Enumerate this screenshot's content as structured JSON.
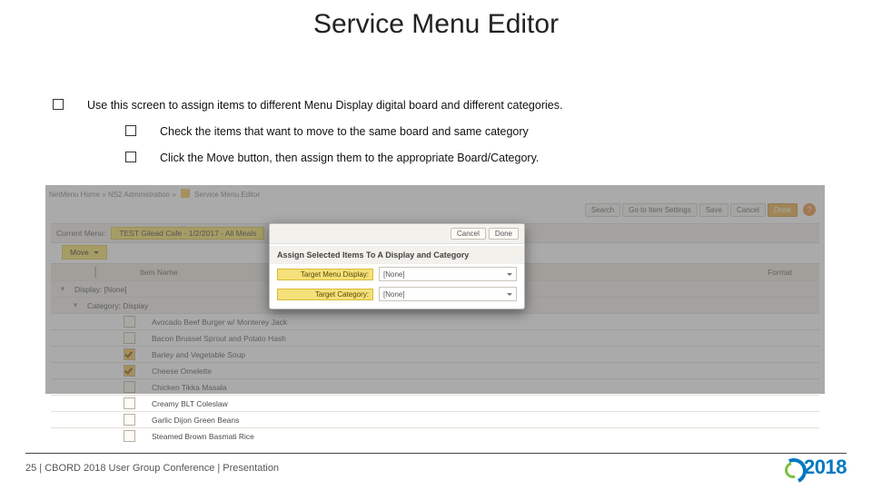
{
  "title": "Service Menu Editor",
  "bullets": {
    "main": "Use this screen to assign items to different Menu Display digital board and different categories.",
    "sub1": "Check the items that want to move to the same board and same category",
    "sub2": "Click the Move button, then assign them to the appropriate Board/Category."
  },
  "screenshot": {
    "breadcrumb": {
      "a": "NetMenu Home",
      "b": "NS2 Administration",
      "c": "Service Menu Editor"
    },
    "toolbar": {
      "search": "Search",
      "goto": "Go to Item Settings",
      "save": "Save",
      "cancel": "Cancel",
      "done": "Done"
    },
    "current_menu": {
      "label": "Current Menu:",
      "value": "TEST Gilead Cafe - 1/2/2017 - All Meals",
      "all": "All"
    },
    "move_btn": "Move",
    "table": {
      "col_item": "Item Name",
      "col_format": "Format",
      "display_row": "Display: [None]",
      "category_row": "Category: Display",
      "items": [
        {
          "name": "Avocado Beef Burger w/ Monterey Jack",
          "checked": false
        },
        {
          "name": "Bacon Brussel Sprout and Potato Hash",
          "checked": false
        },
        {
          "name": "Barley and Vegetable Soup",
          "checked": true
        },
        {
          "name": "Cheese Omelette",
          "checked": true
        },
        {
          "name": "Chicken Tikka Masala",
          "checked": false
        },
        {
          "name": "Creamy BLT Coleslaw",
          "checked": false
        },
        {
          "name": "Garlic Dijon Green Beans",
          "checked": false
        },
        {
          "name": "Steamed Brown Basmati Rice",
          "checked": false
        }
      ]
    },
    "modal": {
      "btn_cancel": "Cancel",
      "btn_done": "Done",
      "title": "Assign Selected Items To A Display and Category",
      "row1_label": "Target Menu Display:",
      "row1_value": "[None]",
      "row2_label": "Target Category:",
      "row2_value": "[None]"
    }
  },
  "footer": {
    "page": "25",
    "sep": " |  ",
    "text": "CBORD 2018 User Group Conference | Presentation"
  },
  "logo": {
    "year": "2018"
  }
}
